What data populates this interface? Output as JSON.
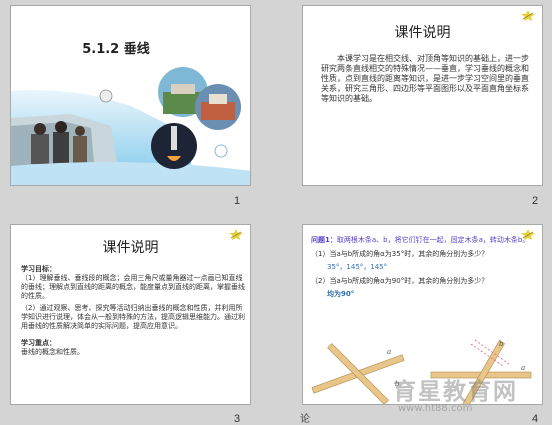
{
  "slides": [
    {
      "number": "1",
      "title": "5.1.2 垂线"
    },
    {
      "number": "2",
      "title": "课件说明",
      "body": "本课学习是在相交线、对顶角等知识的基础上，进一步研究两条直线相交的特殊情况——垂直，学习垂线的概念和性质，点到直线的距离等知识，是进一步学习空间里的垂直关系，研究三角形、四边形等平面图形以及平面直角坐标系等知识的基础。"
    },
    {
      "number": "3",
      "title": "课件说明",
      "goal_head": "学习目标：",
      "goal_1": "（1）理解垂线、垂线段的概念；会用三角尺或量角器过一点画已知直线的垂线；理解点到直线的距离的概念，能度量点到直线的距离，掌握垂线的性质。",
      "goal_2": "（2）通过观察、思考、探究等活动归纳出垂线的概念和性质，并利用所学知识进行说理，体会从一般到特殊的方法，提高逻辑思维能力。通过利用垂线的性质解决简单的实际问题，提高应用意识。",
      "key_head": "学习重点：",
      "key_body": "垂线的概念和性质。"
    },
    {
      "number": "4",
      "q_label": "问题1：",
      "q_text": "取两根木条a、b，将它们钉在一起，固定木条a，转动木条b。",
      "q1": "（1）当a与b所成的角α为35°时，其余的角分别为多少？",
      "a1": "35°，145°，145°",
      "q2": "（2）当a与b所成的角α为90°时，其余的角分别为多少？",
      "a2": "均为90°",
      "fig_labels": [
        "a",
        "b",
        "a",
        "b"
      ]
    }
  ],
  "watermark": {
    "title": "育星教育网",
    "url": "www.ht88.com",
    "stray": "论"
  },
  "colors": {
    "accent": "#5b3ec8",
    "answer": "#2e6fb0",
    "sky": "#6fc1e8"
  },
  "icons": [
    "star-pencil-icon"
  ]
}
